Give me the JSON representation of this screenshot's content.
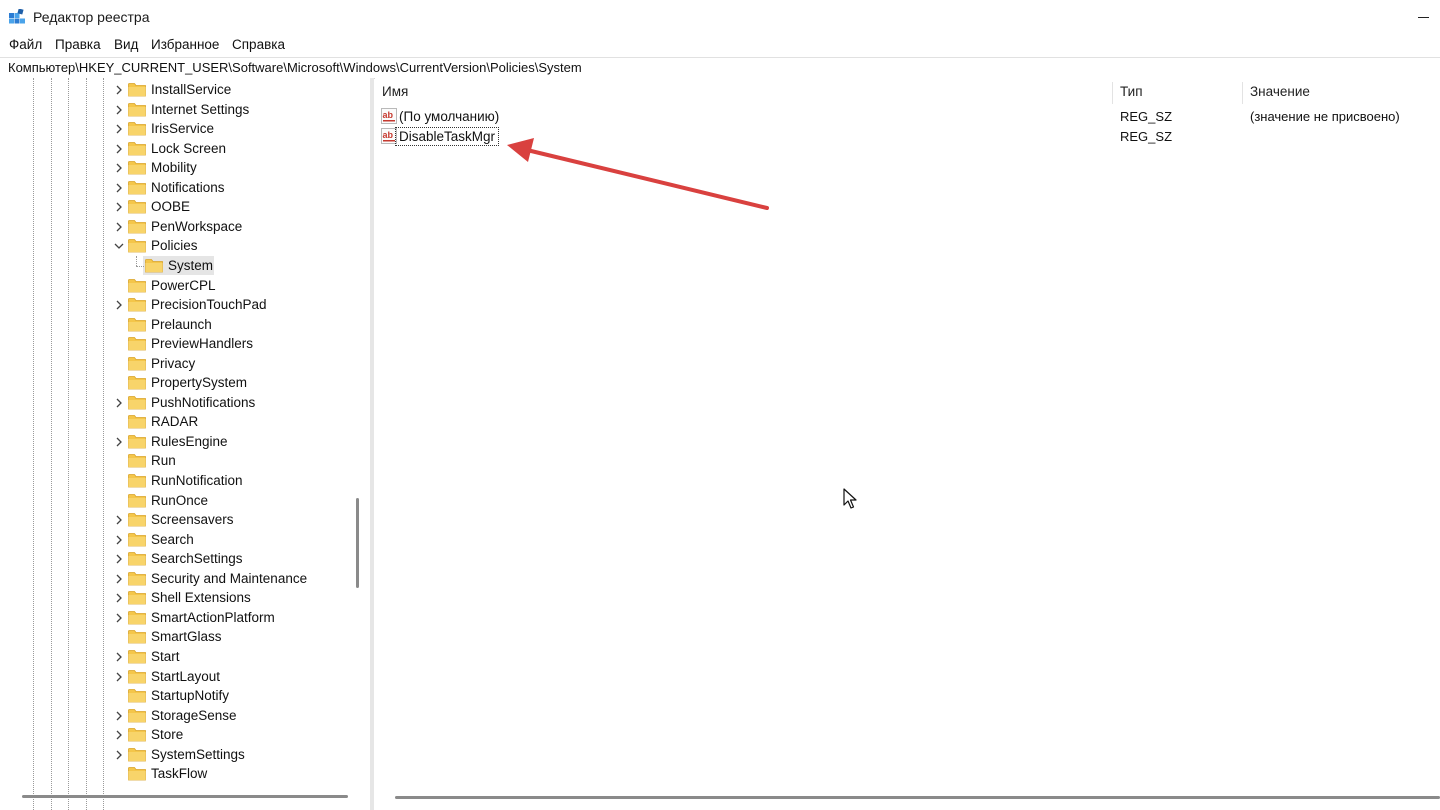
{
  "window": {
    "title": "Редактор реестра"
  },
  "menu": [
    "Файл",
    "Правка",
    "Вид",
    "Избранное",
    "Справка"
  ],
  "address": "Компьютер\\HKEY_CURRENT_USER\\Software\\Microsoft\\Windows\\CurrentVersion\\Policies\\System",
  "tree": {
    "items": [
      {
        "label": "InstallService",
        "expand": "collapsed"
      },
      {
        "label": "Internet Settings",
        "expand": "collapsed"
      },
      {
        "label": "IrisService",
        "expand": "collapsed"
      },
      {
        "label": "Lock Screen",
        "expand": "collapsed"
      },
      {
        "label": "Mobility",
        "expand": "collapsed"
      },
      {
        "label": "Notifications",
        "expand": "collapsed"
      },
      {
        "label": "OOBE",
        "expand": "collapsed"
      },
      {
        "label": "PenWorkspace",
        "expand": "collapsed"
      },
      {
        "label": "Policies",
        "expand": "expanded"
      },
      {
        "label": "System",
        "expand": "none",
        "child": true,
        "selected": true
      },
      {
        "label": "PowerCPL",
        "expand": "none"
      },
      {
        "label": "PrecisionTouchPad",
        "expand": "collapsed"
      },
      {
        "label": "Prelaunch",
        "expand": "none"
      },
      {
        "label": "PreviewHandlers",
        "expand": "none"
      },
      {
        "label": "Privacy",
        "expand": "none"
      },
      {
        "label": "PropertySystem",
        "expand": "none"
      },
      {
        "label": "PushNotifications",
        "expand": "collapsed"
      },
      {
        "label": "RADAR",
        "expand": "none"
      },
      {
        "label": "RulesEngine",
        "expand": "collapsed"
      },
      {
        "label": "Run",
        "expand": "none"
      },
      {
        "label": "RunNotification",
        "expand": "none"
      },
      {
        "label": "RunOnce",
        "expand": "none"
      },
      {
        "label": "Screensavers",
        "expand": "collapsed"
      },
      {
        "label": "Search",
        "expand": "collapsed"
      },
      {
        "label": "SearchSettings",
        "expand": "collapsed"
      },
      {
        "label": "Security and Maintenance",
        "expand": "collapsed"
      },
      {
        "label": "Shell Extensions",
        "expand": "collapsed"
      },
      {
        "label": "SmartActionPlatform",
        "expand": "collapsed"
      },
      {
        "label": "SmartGlass",
        "expand": "none"
      },
      {
        "label": "Start",
        "expand": "collapsed"
      },
      {
        "label": "StartLayout",
        "expand": "collapsed"
      },
      {
        "label": "StartupNotify",
        "expand": "none"
      },
      {
        "label": "StorageSense",
        "expand": "collapsed"
      },
      {
        "label": "Store",
        "expand": "collapsed"
      },
      {
        "label": "SystemSettings",
        "expand": "collapsed"
      },
      {
        "label": "TaskFlow",
        "expand": "none"
      }
    ]
  },
  "list": {
    "columns": {
      "name": "Имя",
      "type": "Тип",
      "data": "Значение"
    },
    "rows": [
      {
        "name": "(По умолчанию)",
        "type": "REG_SZ",
        "data": "(значение не присвоено)",
        "icon": "reg-string-icon"
      },
      {
        "name": "DisableTaskMgr",
        "type": "REG_SZ",
        "data": "",
        "icon": "reg-string-icon",
        "focused": true
      }
    ]
  },
  "colors": {
    "arrow": "#d9413f",
    "folder": "#f4c64a",
    "selection": "#e5e5e5"
  },
  "icons": {
    "app": "registry-editor-icon",
    "annotation": "red-arrow",
    "pointer": "mouse-cursor-icon"
  }
}
